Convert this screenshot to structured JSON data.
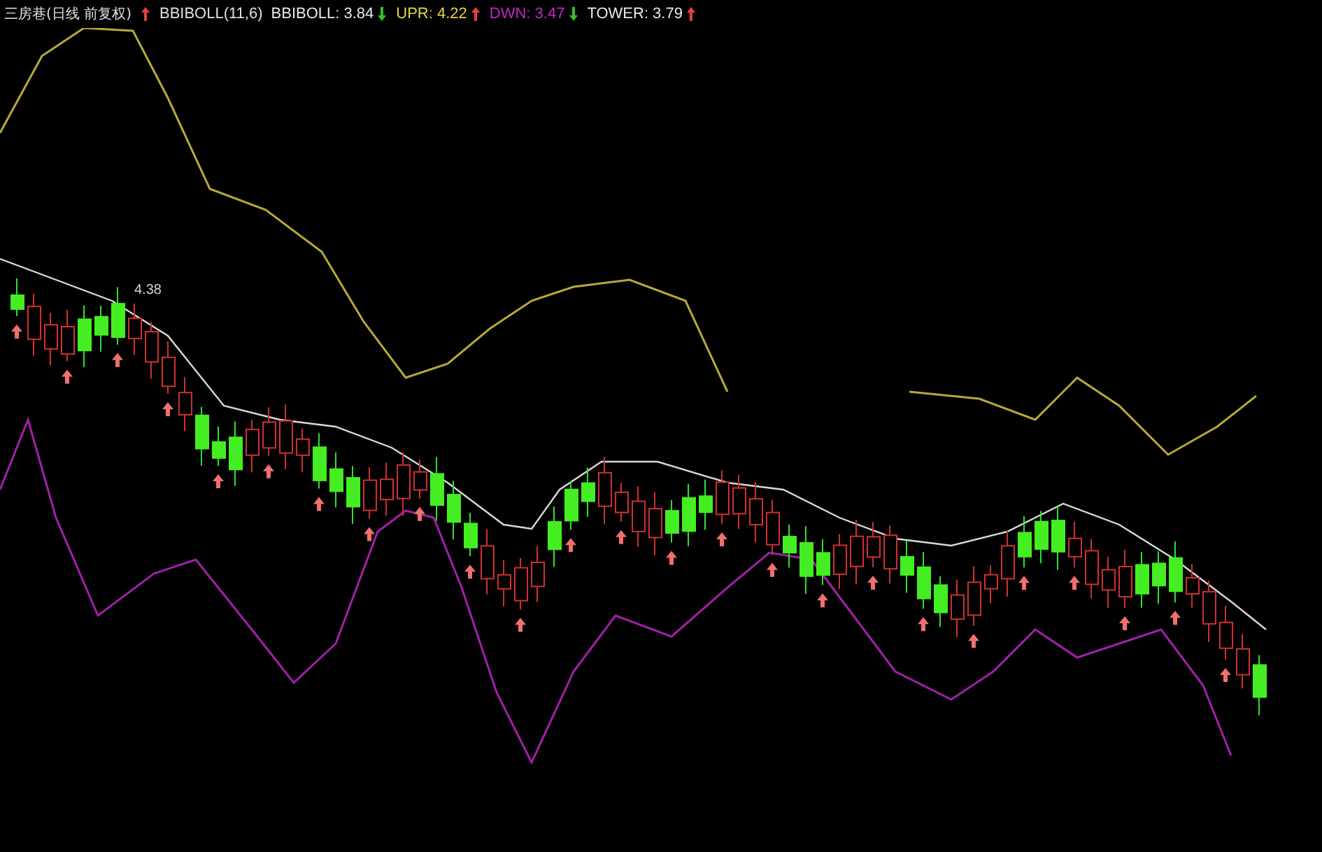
{
  "chart": {
    "title": "三房巷(日线 前复权)",
    "indicator": {
      "label": "BBIBOLL(11,6)",
      "kind": "up"
    },
    "legend": [
      {
        "label": "BBIBOLL: 3.84",
        "color": "#e8e8e8",
        "kind": "down"
      },
      {
        "label": "UPR: 4.22",
        "color": "#e6d34a",
        "kind": "up"
      },
      {
        "label": "DWN: 3.47",
        "color": "#c028c8",
        "kind": "down"
      },
      {
        "label": "TOWER: 3.79",
        "color": "#e8e8e8",
        "kind": "up"
      }
    ],
    "peak_label": "4.38"
  }
}
